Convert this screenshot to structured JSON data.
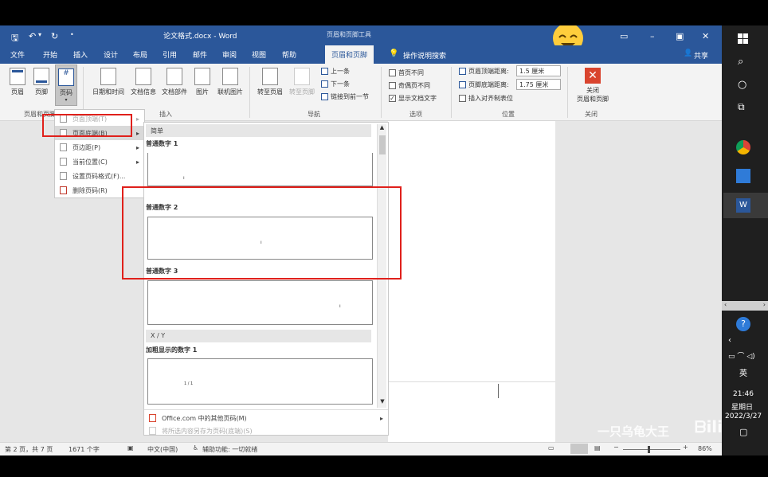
{
  "title": {
    "doc": "论文格式.docx - Word",
    "context_tool": "页眉和页脚工具",
    "minimize": "–",
    "restore": "▣",
    "close": "✕"
  },
  "menu": {
    "tabs": [
      "文件",
      "开始",
      "插入",
      "设计",
      "布局",
      "引用",
      "邮件",
      "审阅",
      "视图",
      "帮助"
    ],
    "active_tab": "页眉和页脚",
    "tell_me": "操作说明搜索",
    "share": "共享"
  },
  "ribbon": {
    "header_footer": {
      "header": "页眉",
      "footer": "页脚",
      "page_number": "页码",
      "group": "页眉和页脚"
    },
    "insert": {
      "datetime": "日期和时间",
      "docinfo": "文档信息",
      "parts": "文档部件",
      "picture": "图片",
      "online_picture": "联机图片",
      "group": "插入"
    },
    "nav": {
      "goto_header": "转至页眉",
      "goto_footer": "转至页脚",
      "prev": "上一条",
      "next": "下一条",
      "link_prev": "链接到前一节",
      "group": "导航"
    },
    "options": {
      "first_page": "首页不同",
      "odd_even": "奇偶页不同",
      "show_doc_text": "显示文档文字",
      "group": "选项"
    },
    "position": {
      "header_top": "页眉顶端距离:",
      "header_top_value": "1.5 厘米",
      "footer_bottom": "页脚底端距离:",
      "footer_bottom_value": "1.75 厘米",
      "insert_align_tab": "插入对齐制表位",
      "group": "位置"
    },
    "close": {
      "label_line1": "关闭",
      "label_line2": "页眉和页脚",
      "group": "关闭"
    }
  },
  "page_number_menu": {
    "items": [
      "页面顶端(T)",
      "页面底端(B)",
      "页边距(P)",
      "当前位置(C)",
      "设置页码格式(F)...",
      "删除页码(R)"
    ]
  },
  "gallery": {
    "section_simple": "简单",
    "items": [
      "普通数字 1",
      "普通数字 2",
      "普通数字 3"
    ],
    "section_xy": "X / Y",
    "bold_item": "加粗显示的数字 1",
    "xy_sample": "1 / 1",
    "more_online": "Office.com 中的其他页码(M)",
    "save_selection": "将所选内容另存为页码(底端)(S)"
  },
  "status": {
    "page": "第 2 页，共 7 页",
    "words": "1671 个字",
    "lang": "中文(中国)",
    "accessibility": "辅助功能: 一切就绪",
    "zoom": "86%"
  },
  "taskbar": {
    "lang": "英",
    "time": "21:46",
    "weekday": "星期日",
    "date": "2022/3/27"
  },
  "watermark": "一只乌龟大王",
  "colors": {
    "word_blue": "#2b579a",
    "highlight_red": "#e0201b"
  }
}
